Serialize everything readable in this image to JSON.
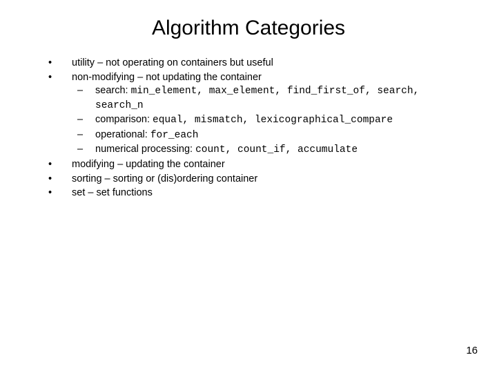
{
  "title": "Algorithm Categories",
  "b1": "utility – not operating on containers but useful",
  "b2": "non-modifying – not updating the container",
  "b2s1_label": "search: ",
  "b2s1_code": "min_element, max_element, find_first_of, search, search_n",
  "b2s2_label": "comparison: ",
  "b2s2_code": "equal, mismatch, lexicographical_compare",
  "b2s3_label": "operational: ",
  "b2s3_code": "for_each",
  "b2s4_label": "numerical processing: ",
  "b2s4_code": "count, count_if, accumulate",
  "b3": "modifying – updating the container",
  "b4": "sorting – sorting or (dis)ordering container",
  "b5": "set – set functions",
  "pagenum": "16"
}
